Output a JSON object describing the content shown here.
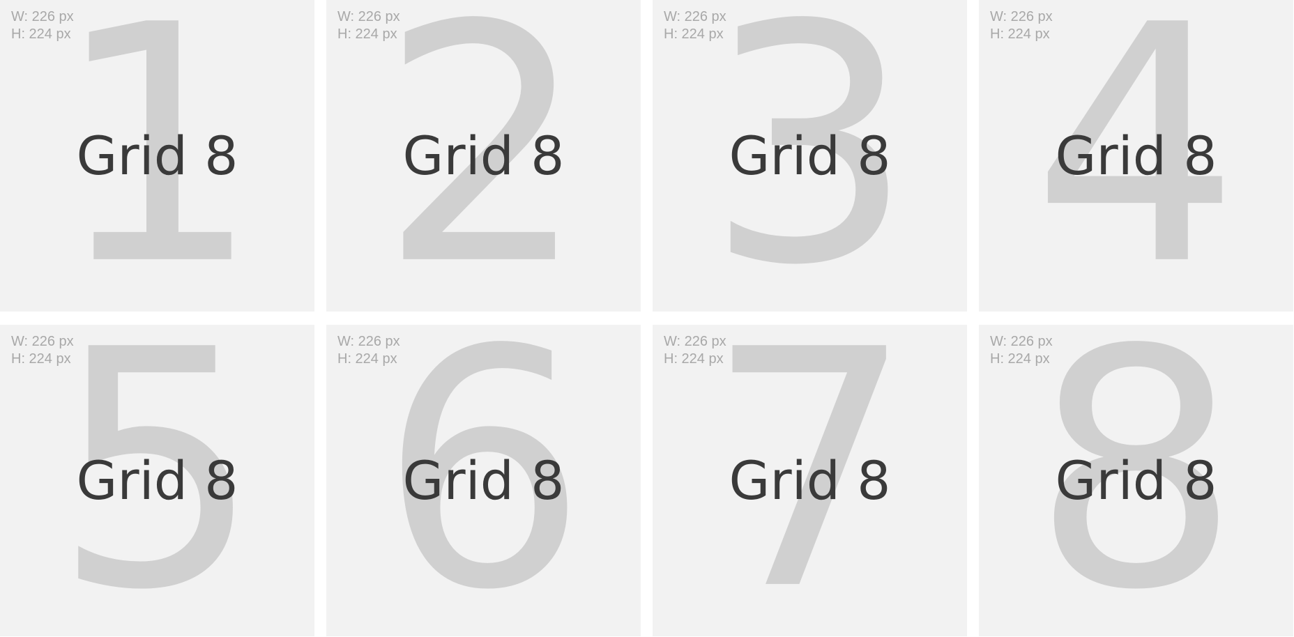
{
  "cells": [
    {
      "number": "1",
      "width_text": "W: 226 px",
      "height_text": "H: 224 px",
      "label": "Grid 8"
    },
    {
      "number": "2",
      "width_text": "W: 226 px",
      "height_text": "H: 224 px",
      "label": "Grid 8"
    },
    {
      "number": "3",
      "width_text": "W: 226 px",
      "height_text": "H: 224 px",
      "label": "Grid 8"
    },
    {
      "number": "4",
      "width_text": "W: 226 px",
      "height_text": "H: 224 px",
      "label": "Grid 8"
    },
    {
      "number": "5",
      "width_text": "W: 226 px",
      "height_text": "H: 224 px",
      "label": "Grid 8"
    },
    {
      "number": "6",
      "width_text": "W: 226 px",
      "height_text": "H: 224 px",
      "label": "Grid 8"
    },
    {
      "number": "7",
      "width_text": "W: 226 px",
      "height_text": "H: 224 px",
      "label": "Grid 8"
    },
    {
      "number": "8",
      "width_text": "W: 226 px",
      "height_text": "H: 224 px",
      "label": "Grid 8"
    }
  ],
  "colors": {
    "cell_background": "#f2f2f2",
    "big_number": "#d0d0d0",
    "label_text": "#3a3a3a",
    "dims_text": "#a8a8a8"
  }
}
